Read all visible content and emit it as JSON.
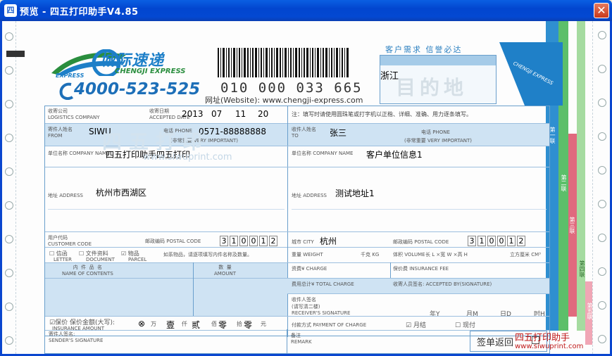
{
  "window": {
    "title": "预览 - 四五打印助手V4.85",
    "icon_text": "四",
    "close_glyph": "✕"
  },
  "waybill": {
    "logo_cn": "城际速递",
    "logo_en": "CHENGJI EXPRESS",
    "logo_express": "EXPRESS",
    "phone": "4000-523-525",
    "barcode_number": "010 000 033 665",
    "website": "网址(Website): www.chengji-express.com",
    "dest_heading": "客户需求  信誉必达",
    "dest_watermark": "目的地",
    "destination": "浙江",
    "notice": "注：填写时请使用圆珠笔或打字机以正楷、详细、准确、用力逐条填写。",
    "watermark_text": "四五打印",
    "watermark_url": "www.siwuprint.com"
  },
  "sender": {
    "company_label": "收寄公司\nLOGISTICS COMPANY",
    "date_label": "收寄日期\nACCEPTED DATE",
    "date_year": "2013",
    "date_month": "07",
    "date_day": "11",
    "date_hour": "20",
    "name_label": "寄件人姓名\nFROM",
    "name": "SIWU",
    "phone_label": "电话 PHONE",
    "phone": "0571-88888888",
    "phone_note": "(非常重要 VERY IMPORTANT)",
    "unit_label": "单位名称 COMPANY NAME",
    "unit": "四五打印助手四五打印",
    "address_label": "地址 ADDRESS",
    "address": "杭州市西湖区",
    "customer_code_label": "用户代码\nCUSTOMER CODE",
    "postal_label": "邮政编码 POSTAL CODE",
    "postal_digits": [
      "3",
      "1",
      "0",
      "0",
      "1",
      "2"
    ]
  },
  "receiver": {
    "name_label": "收件人姓名\nTO",
    "name": "张三",
    "phone_label": "电话 PHONE",
    "phone_note": "(非常重要 VERY IMPORTANT)",
    "unit_label": "单位名称 COMPANY NAME",
    "unit": "客户单位信息1",
    "address_label": "地址 ADDRESS",
    "address": "测试地址1",
    "city_label": "城市 CITY",
    "city": "杭州",
    "postal_label": "邮政编码 POSTAL CODE",
    "postal_digits": [
      "3",
      "1",
      "0",
      "0",
      "1",
      "2"
    ]
  },
  "goods": {
    "letter": "信函",
    "letter_en": "LETTER",
    "document": "文件资料",
    "document_en": "DOCUMENT",
    "parcel": "物品",
    "parcel_en": "PARCEL",
    "note": "如系物品，请逐项填写内件名称及数量。",
    "content_label": "内  件  品  名\nNAME OF CONTENTS",
    "quantity_label": "数  量\nAMOUNT",
    "insurance_label": "保价  保价金额(大写):",
    "insurance_en": "INSURANCE AMOUNT",
    "insurance_units": [
      "万",
      "仟",
      "佰",
      "拾",
      "元"
    ],
    "insurance_values": [
      "⊗",
      "壹",
      "贰",
      "零",
      "零"
    ],
    "signature_label": "寄件人签名:\nSENDER'S SIGNATURE"
  },
  "charges": {
    "weight_label": "重量 WEIGHT",
    "weight_unit": "千克 KG",
    "volume_label": "体积 VOLUME",
    "volume_dims": "长 L  ×宽 W  ×高 H",
    "volume_unit": "立方厘米 CM³",
    "charge_label": "资费¥ CHARGE",
    "insurance_fee_label": "保价费 INSURANCE FEE",
    "total_label": "费用总计¥ TOTAL CHARGE",
    "accepted_label": "收寄人员签名: ACCEPTED BY(SIGNATURE)",
    "receiver_sign_label": "收件人签名\n(请写清二楼)\nRECEIVER'S SIGNATURE",
    "date_parts": [
      "年Y",
      "月M",
      "日D",
      "时H"
    ],
    "payment_label": "付款方式 PAYMENT OF CHARGE",
    "monthly": "月结",
    "cash": "现付",
    "remark_label": "备注\nREMARK",
    "return_sign": "签单返回"
  },
  "side_tabs": [
    "第一联",
    "第二联",
    "第三联",
    "第四联",
    "第五联"
  ],
  "footer": {
    "brand": "四五打印助手",
    "url": "www.siwuprint.com"
  },
  "colors": {
    "title_blue": "#0A46CF",
    "form_blue": "#6a9fcc",
    "band_blue": "#cfe3f3",
    "brand_red": "#c01a1a",
    "logo_blue": "#1d7fc8",
    "logo_green": "#2a8e3e"
  }
}
